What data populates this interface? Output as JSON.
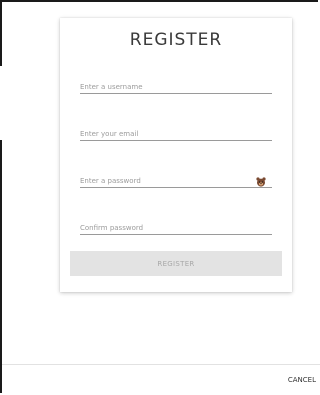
{
  "form": {
    "title": "REGISTER",
    "username_placeholder": "Enter a username",
    "email_placeholder": "Enter your email",
    "password_placeholder": "Enter a password",
    "confirm_placeholder": "Confirm password",
    "reveal_icon": "bear-face-icon",
    "submit_label": "REGISTER"
  },
  "footer": {
    "cancel_label": "CANCEL"
  },
  "colors": {
    "submit_background": "#e3e3e3",
    "submit_text": "#a8a8a8",
    "placeholder_text": "#9b9b9b",
    "reveal_icon": "#7a4a32"
  }
}
